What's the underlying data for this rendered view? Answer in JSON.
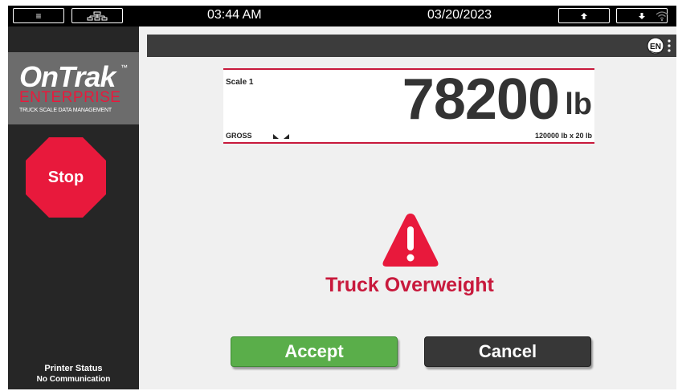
{
  "topbar": {
    "time": "03:44 AM",
    "date": "03/20/2023"
  },
  "sidebar": {
    "logo": {
      "main": "OnTrak",
      "trademark": "™",
      "sub": "ENTERPRISE",
      "tagline": "TRUCK SCALE DATA MANAGEMENT"
    },
    "stop_label": "Stop",
    "printer": {
      "title": "Printer Status",
      "status": "No Communication"
    }
  },
  "header": {
    "language": "EN"
  },
  "scale": {
    "name": "Scale 1",
    "weight": "78200",
    "unit": "lb",
    "mode": "GROSS",
    "capacity": "120000 lb x 20 lb"
  },
  "alert": {
    "message": "Truck Overweight"
  },
  "actions": {
    "accept_label": "Accept",
    "cancel_label": "Cancel"
  },
  "colors": {
    "accent_red": "#e8193c",
    "accept_green": "#5aae4a",
    "cancel_dark": "#373737",
    "sidebar_bg": "#262626"
  }
}
